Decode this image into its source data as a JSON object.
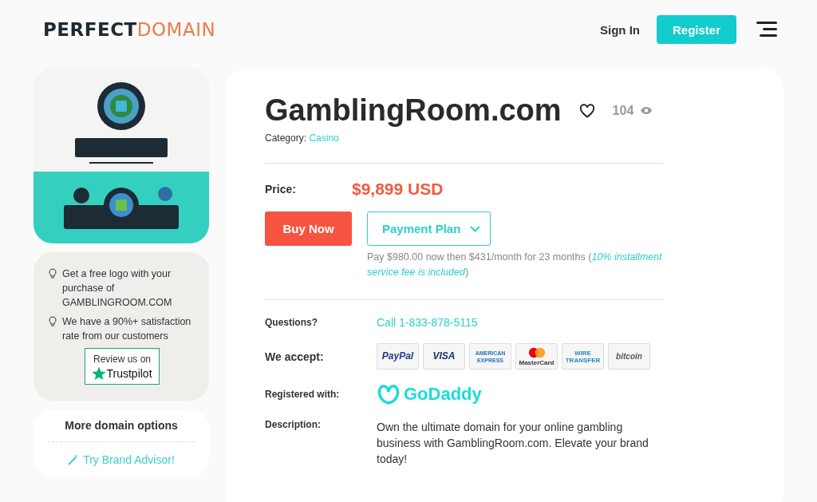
{
  "header": {
    "logo": {
      "part_1": "PERFECT",
      "part_2": "DOMAIN"
    },
    "sign_in": "Sign In",
    "register": "Register"
  },
  "sidebar": {
    "tips": [
      "Get a free logo with your purchase of GAMBLINGROOM.COM",
      "We have a 90%+ satisfaction rate from our customers"
    ],
    "review": {
      "line_1": "Review us on",
      "line_2": "Trustpilot"
    },
    "more": {
      "title": "More domain options",
      "link": "Try Brand Advisor!"
    }
  },
  "domain": {
    "name": "GamblingRoom.com",
    "views": "104",
    "category_label": "Category:",
    "category": "Casino",
    "price_label": "Price:",
    "price": "$9,899 USD",
    "buy": "Buy Now",
    "plan": "Payment Plan",
    "plan_note": "Pay $980.00 now then $431/month for 23 months (",
    "plan_fee": "10% installment service fee is included",
    "plan_close": ")",
    "questions_label": "Questions?",
    "phone": "Call 1-833-878-5115",
    "accept_label": "We accept:",
    "payments": [
      {
        "kind": "paypal",
        "label": "PayPal"
      },
      {
        "kind": "visa",
        "label": "VISA"
      },
      {
        "kind": "amex",
        "label": "AMERICAN EXPRESS"
      },
      {
        "kind": "mastercard",
        "label": "MasterCard"
      },
      {
        "kind": "wire",
        "label": "WIRE TRANSFER"
      },
      {
        "kind": "bitcoin",
        "label": "bitcoin"
      }
    ],
    "registrar_label": "Registered with:",
    "registrar": "GoDaddy",
    "description_label": "Description:",
    "description": "Own the ultimate domain for your online gambling business with GamblingRoom.com. Elevate your brand today!"
  }
}
